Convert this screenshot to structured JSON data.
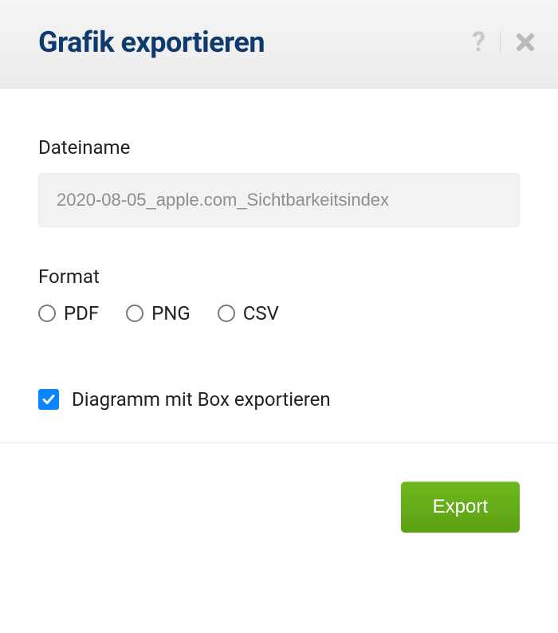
{
  "dialog": {
    "title": "Grafik exportieren"
  },
  "form": {
    "filename_label": "Dateiname",
    "filename_value": "2020-08-05_apple.com_Sichtbarkeitsindex",
    "format_label": "Format",
    "formats": [
      "PDF",
      "PNG",
      "CSV"
    ],
    "checkbox_label": "Diagramm mit Box exportieren",
    "checkbox_checked": true
  },
  "footer": {
    "export_label": "Export"
  }
}
